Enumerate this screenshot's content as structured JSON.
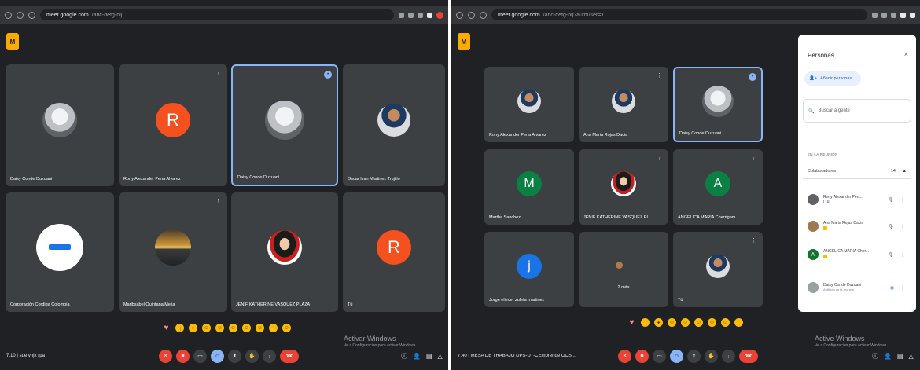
{
  "left": {
    "url_domain": "meet.google.com",
    "url_path": "/abc-defg-hij",
    "meet_badge": "M",
    "tiles": [
      {
        "name": "Daisy Conde Duzuani"
      },
      {
        "name": "Rony Alexander Pena Alvarez",
        "initial": "R"
      },
      {
        "name": "Daisy Conde Duzuani"
      },
      {
        "name": "Oscar Ivan Martinez Trujillo"
      },
      {
        "name": "Corporación Cordiga Colombia"
      },
      {
        "name": "Maribsabel Quintana Mejia"
      },
      {
        "name": "JENIF KATHERINE VASQUEZ PLAZA"
      },
      {
        "name": "Tú",
        "initial": "R"
      }
    ],
    "meeting_info": "7:10 | sue vnjx rpa",
    "watermark_title": "Activar Windows",
    "watermark_sub": "Ve a Configuración para activar Windows."
  },
  "right": {
    "url_domain": "meet.google.com",
    "url_path": "/abc-defg-hij?authuser=1",
    "meet_badge": "M",
    "tiles": [
      {
        "name": "Rony Alexander Pena Alvarez"
      },
      {
        "name": "Ana Maria Rojas Dacia"
      },
      {
        "name": "Daisy Conde Duzuani"
      },
      {
        "name": "Martha Sanchez",
        "initial": "M"
      },
      {
        "name": "JENIF KATHERINE VASQUEZ PL..."
      },
      {
        "name": "ANGELICA MARIA Cherrigam...",
        "initial": "A"
      },
      {
        "name": "Jorge eliecer zuleta martinez",
        "initial": "j"
      },
      {
        "name": "2 más"
      },
      {
        "name": "Tú"
      }
    ],
    "meeting_info": "7:40 | MESA DE TRABAJO DPS-UT-CEmprende OCS...",
    "watermark_title": "Active Windows",
    "watermark_sub": "Ve a Configuración para activar Windows."
  },
  "people_panel": {
    "title": "Personas",
    "close": "×",
    "add_people": "Añadir personas",
    "search_placeholder": "Buscar a gente",
    "section_label": "EN LA REUNIÓN",
    "collaborators_label": "Colaboradores",
    "collaborators_count": "14",
    "people": [
      {
        "name": "Rony Alexander Pen... (Tú)",
        "avatar_color": "#5f6368"
      },
      {
        "name": "Ana Maria Rojas Dacia",
        "avatar_color": "#9e7b4f"
      },
      {
        "name": "ANGELICA MARIA Cher...",
        "initial": "A",
        "avatar_color": "#137333"
      },
      {
        "name": "Daisy Conde Duzuani",
        "sub": "Anfitrión de la reunión",
        "avatar_color": "#9aa0a6"
      }
    ]
  },
  "colors": {
    "meet_background": "#202124",
    "tile_background": "#3c4043",
    "active_speaker": "#8ab4f8",
    "hangup_red": "#ea4335",
    "avatar_orange": "#f4511e",
    "avatar_green": "#0b8043",
    "avatar_blue": "#1a73e8"
  }
}
